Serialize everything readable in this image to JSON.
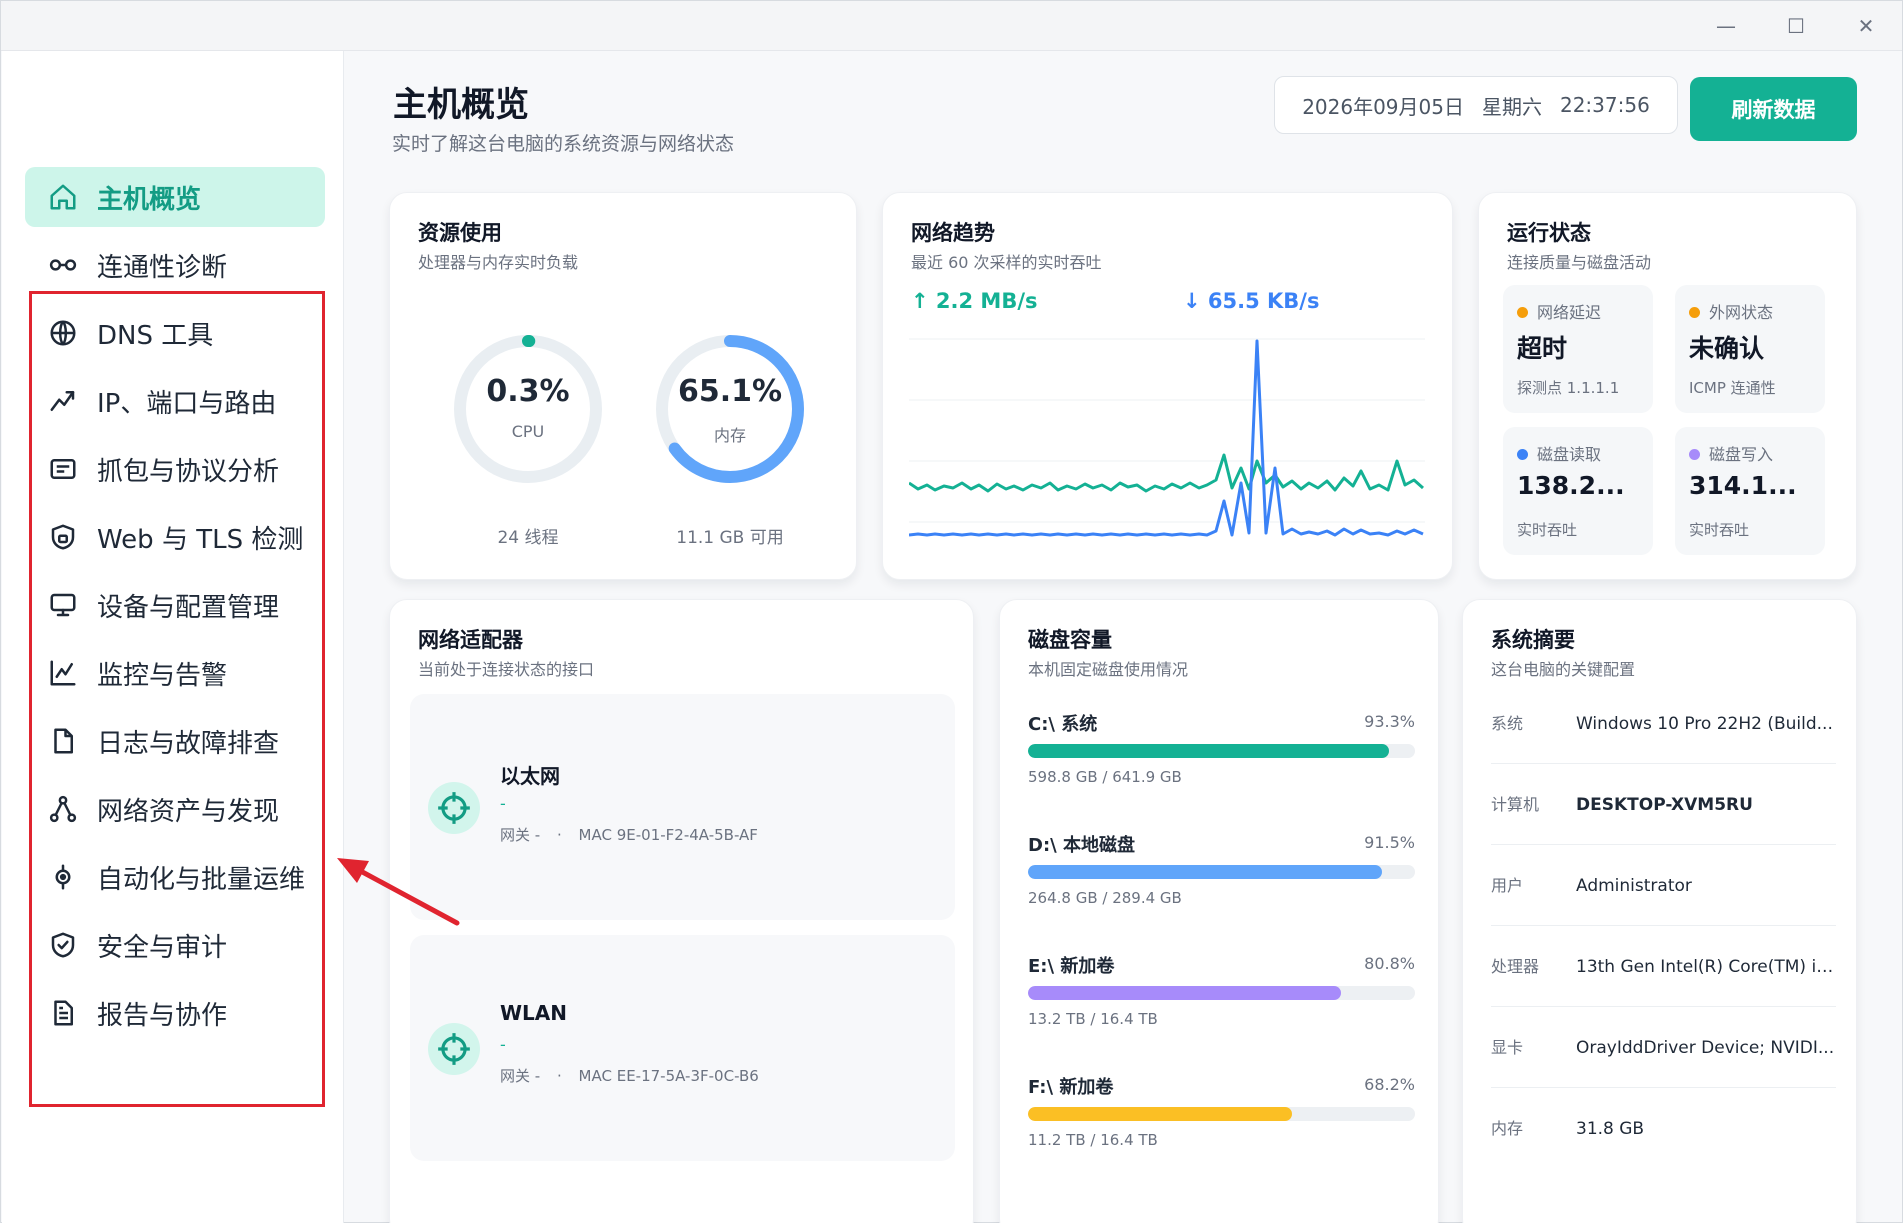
{
  "window": {
    "minimize": "—",
    "maximize": "☐",
    "close": "✕"
  },
  "sidebar": {
    "items": [
      {
        "label": "主机概览",
        "icon": "home-icon",
        "active": true
      },
      {
        "label": "连通性诊断",
        "icon": "link-icon"
      },
      {
        "label": "DNS 工具",
        "icon": "globe-icon"
      },
      {
        "label": "IP、端口与路由",
        "icon": "route-icon"
      },
      {
        "label": "抓包与协议分析",
        "icon": "packet-icon"
      },
      {
        "label": "Web 与 TLS 检测",
        "icon": "shield-lock-icon"
      },
      {
        "label": "设备与配置管理",
        "icon": "monitor-icon"
      },
      {
        "label": "监控与告警",
        "icon": "chart-line-icon"
      },
      {
        "label": "日志与故障排查",
        "icon": "file-icon"
      },
      {
        "label": "网络资产与发现",
        "icon": "network-nodes-icon"
      },
      {
        "label": "自动化与批量运维",
        "icon": "automation-icon"
      },
      {
        "label": "安全与审计",
        "icon": "shield-check-icon"
      },
      {
        "label": "报告与协作",
        "icon": "report-icon"
      }
    ]
  },
  "header": {
    "title": "主机概览",
    "subtitle": "实时了解这台电脑的系统资源与网络状态",
    "date": "2026年09月05日",
    "weekday": "星期六",
    "time": "22:37:56",
    "refresh_label": "刷新数据"
  },
  "resource": {
    "title": "资源使用",
    "subtitle": "处理器与内存实时负载",
    "cpu": {
      "value": "0.3%",
      "label": "CPU",
      "foot": "24 线程",
      "fraction": 0.003
    },
    "memory": {
      "value": "65.1%",
      "label": "内存",
      "foot": "11.1 GB 可用",
      "fraction": 0.651
    }
  },
  "trend": {
    "title": "网络趋势",
    "subtitle": "最近 60 次采样的实时吞吐",
    "up_rate": "↑ 2.2 MB/s",
    "down_rate": "↓ 65.5 KB/s",
    "colors": {
      "up": "#14b194",
      "down": "#3b82f6"
    }
  },
  "status": {
    "title": "运行状态",
    "subtitle": "连接质量与磁盘活动",
    "tiles": [
      {
        "label": "网络延迟",
        "value": "超时",
        "foot": "探测点 1.1.1.1",
        "color": "#f59e0b"
      },
      {
        "label": "外网状态",
        "value": "未确认",
        "foot": "ICMP 连通性",
        "color": "#f59e0b"
      },
      {
        "label": "磁盘读取",
        "value": "138.2...",
        "foot": "实时吞吐",
        "color": "#3b82f6"
      },
      {
        "label": "磁盘写入",
        "value": "314.1...",
        "foot": "实时吞吐",
        "color": "#a78bfa"
      }
    ]
  },
  "adapters": {
    "title": "网络适配器",
    "subtitle": "当前处于连接状态的接口",
    "items": [
      {
        "name": "以太网",
        "status": "-",
        "gateway": "网关 -",
        "mac": "MAC 9E-01-F2-4A-5B-AF"
      },
      {
        "name": "WLAN",
        "status": "-",
        "gateway": "网关 -",
        "mac": "MAC EE-17-5A-3F-0C-B6"
      }
    ]
  },
  "disks": {
    "title": "磁盘容量",
    "subtitle": "本机固定磁盘使用情况",
    "items": [
      {
        "name": "C:\\ 系统",
        "percent": "93.3%",
        "fraction": 0.933,
        "usage": "598.8 GB / 641.9 GB",
        "color": "#14b194"
      },
      {
        "name": "D:\\ 本地磁盘",
        "percent": "91.5%",
        "fraction": 0.915,
        "usage": "264.8 GB / 289.4 GB",
        "color": "#60a5fa"
      },
      {
        "name": "E:\\ 新加卷",
        "percent": "80.8%",
        "fraction": 0.808,
        "usage": "13.2 TB / 16.4 TB",
        "color": "#a78bfa"
      },
      {
        "name": "F:\\ 新加卷",
        "percent": "68.2%",
        "fraction": 0.682,
        "usage": "11.2 TB / 16.4 TB",
        "color": "#fbbf24"
      }
    ]
  },
  "summary": {
    "title": "系统摘要",
    "subtitle": "这台电脑的关键配置",
    "rows": [
      {
        "key": "系统",
        "value": "Windows 10 Pro 22H2 (Build..."
      },
      {
        "key": "计算机",
        "value": "DESKTOP-XVM5RU"
      },
      {
        "key": "用户",
        "value": "Administrator"
      },
      {
        "key": "处理器",
        "value": "13th Gen Intel(R) Core(TM) i7..."
      },
      {
        "key": "显卡",
        "value": "OrayIddDriver Device; NVIDI..."
      },
      {
        "key": "内存",
        "value": "31.8 GB"
      }
    ]
  }
}
